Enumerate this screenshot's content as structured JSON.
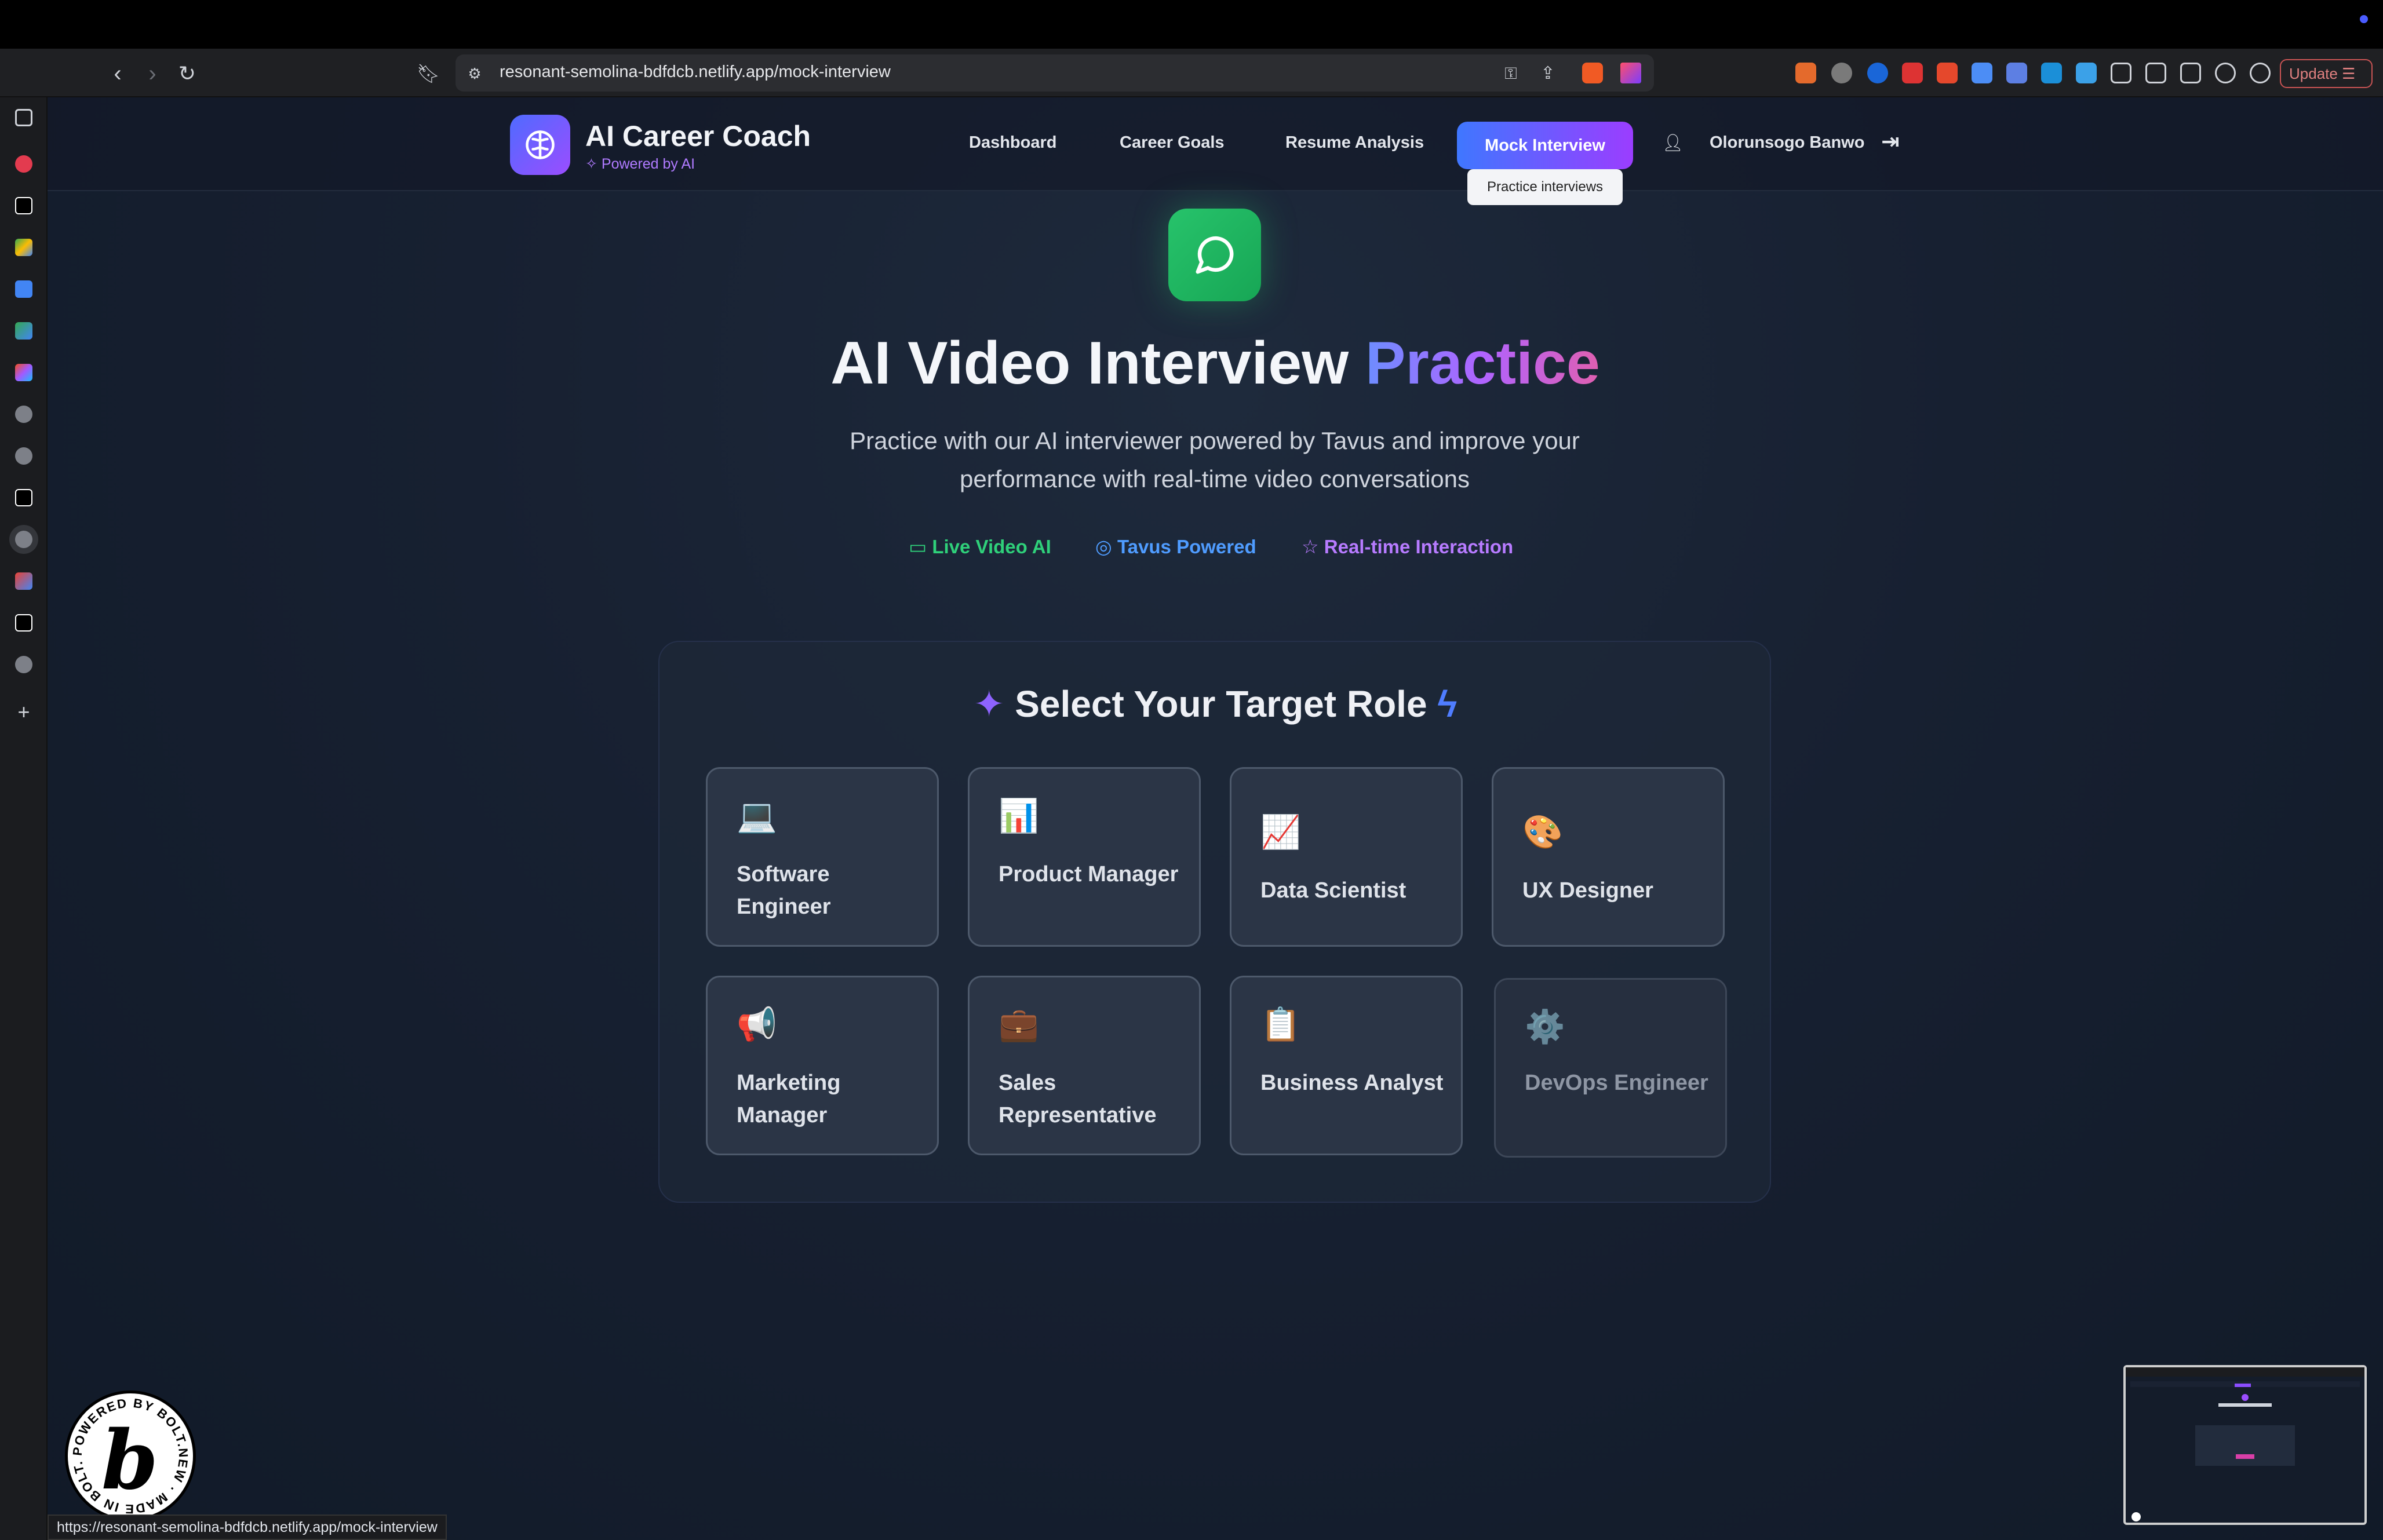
{
  "browser": {
    "url": "resonant-semolina-bdfdcb.netlify.app/mock-interview",
    "update_label": "Update",
    "status_url": "https://resonant-semolina-bdfdcb.netlify.app/mock-interview"
  },
  "header": {
    "brand_title": "AI Career Coach",
    "brand_subtitle": "Powered by AI",
    "nav": [
      "Dashboard",
      "Career Goals",
      "Resume Analysis",
      "Mock Interview"
    ],
    "active_tooltip": "Practice interviews",
    "user_name": "Olorunsogo Banwo"
  },
  "hero": {
    "title_main": "AI Video Interview",
    "title_accent": "Practice",
    "description": "Practice with our AI interviewer powered by Tavus and improve your performance with real-time video conversations",
    "features": [
      {
        "label": "Live Video AI",
        "color": "#2fd07a"
      },
      {
        "label": "Tavus Powered",
        "color": "#4f9cff"
      },
      {
        "label": "Real-time Interaction",
        "color": "#b77bff"
      }
    ]
  },
  "roles": {
    "title": "Select Your Target Role",
    "items": [
      {
        "emoji": "💻",
        "label": "Software Engineer"
      },
      {
        "emoji": "📊",
        "label": "Product Manager"
      },
      {
        "emoji": "📈",
        "label": "Data Scientist"
      },
      {
        "emoji": "🎨",
        "label": "UX Designer"
      },
      {
        "emoji": "📢",
        "label": "Marketing Manager"
      },
      {
        "emoji": "💼",
        "label": "Sales Representative"
      },
      {
        "emoji": "📋",
        "label": "Business Analyst"
      },
      {
        "emoji": "⚙️",
        "label": "DevOps Engineer"
      }
    ]
  },
  "badge": {
    "text": "POWERED BY BOLT.NEW · MADE IN BOLT.NEW"
  }
}
